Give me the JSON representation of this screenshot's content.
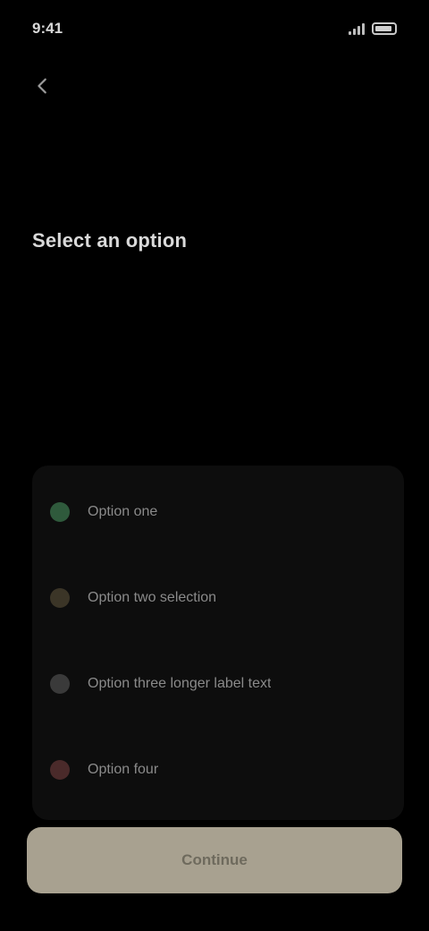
{
  "status_bar": {
    "time": "9:41"
  },
  "title": "Select an option",
  "options": [
    {
      "label": "Option one",
      "color": "#2f5a3c"
    },
    {
      "label": "Option two selection",
      "color": "#3b3527"
    },
    {
      "label": "Option three longer label text",
      "color": "#3a3a3a"
    },
    {
      "label": "Option four",
      "color": "#4a2a2a"
    }
  ],
  "continue": {
    "label": "Continue"
  },
  "colors": {
    "background": "#000000",
    "card": "#0d0d0d",
    "accent": "#a8a190"
  },
  "icons": {
    "back": "chevron-left-icon"
  }
}
